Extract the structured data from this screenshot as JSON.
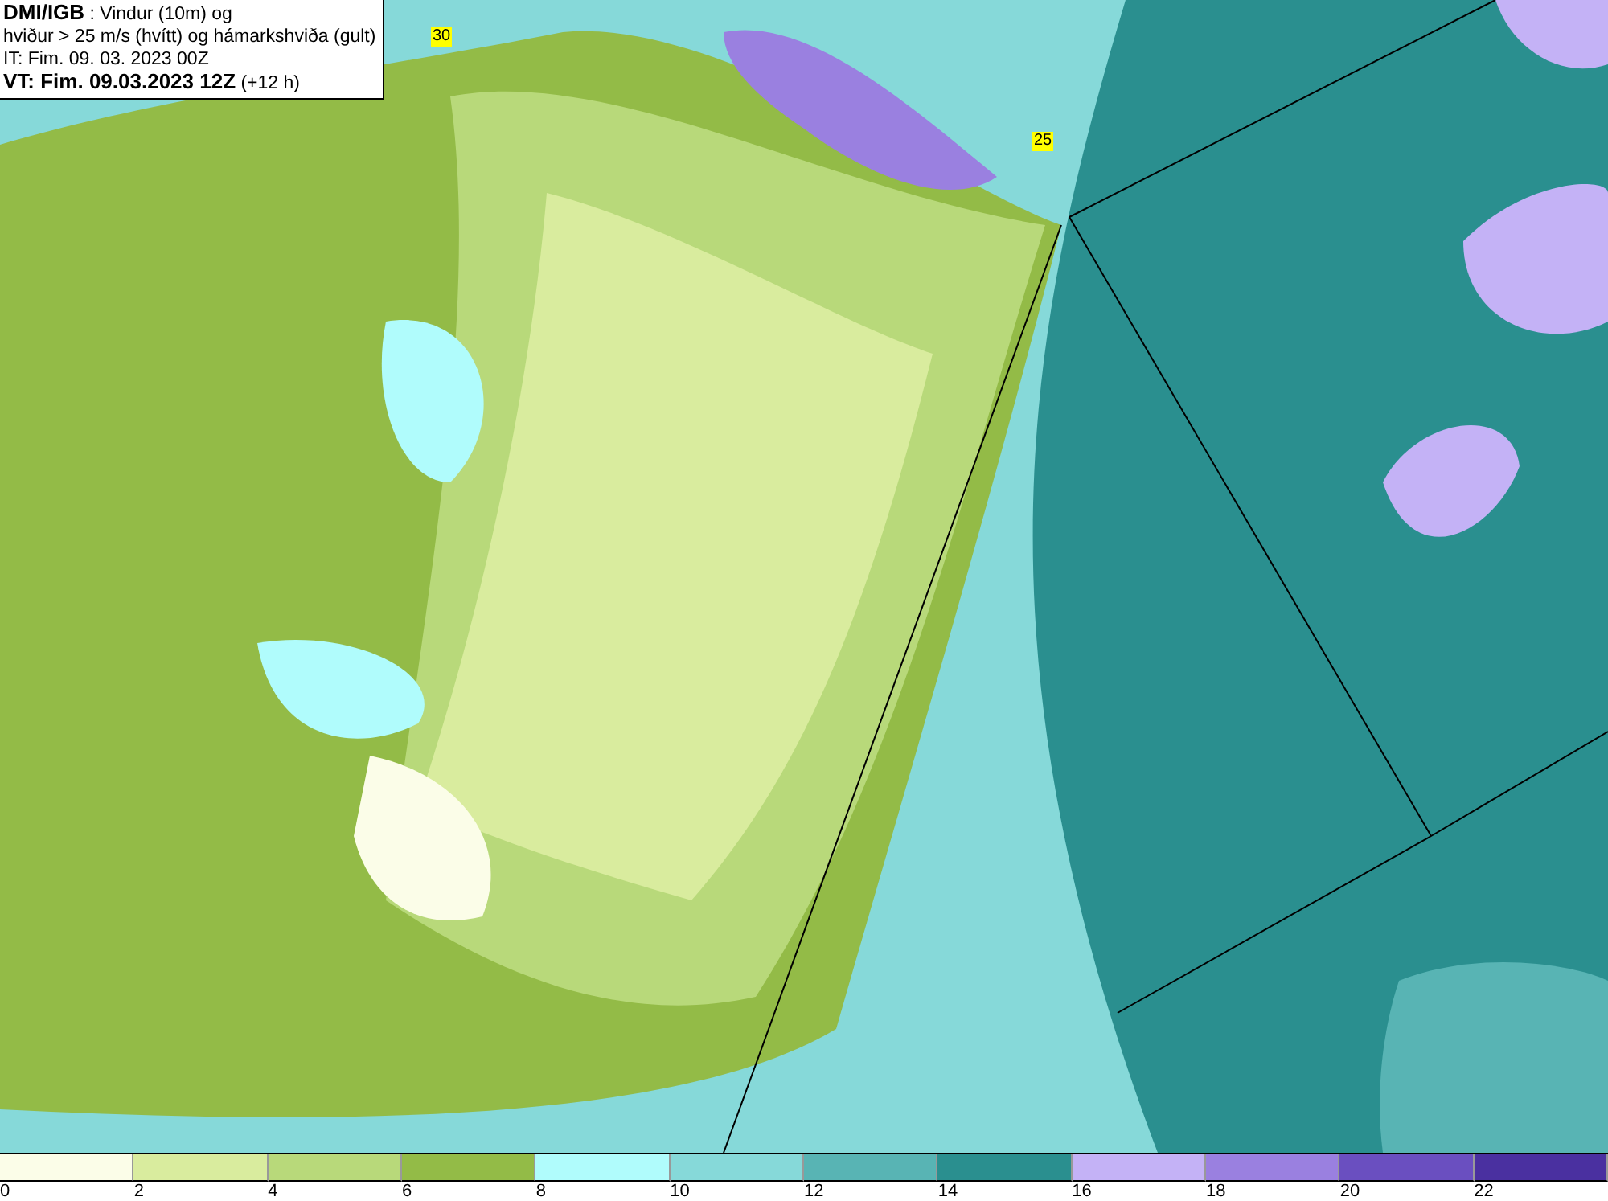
{
  "title_box": {
    "lines": [
      "**DMI/IGB** : Vindur (10m) og",
      "hviður > 25 m/s (hvítt) og hámarkshviða (gult)",
      "IT: Fim. 09. 03. 2023 00Z",
      "**VT: Fim. 09.03.2023 12Z** (+12 h)"
    ]
  },
  "map": {
    "gust_labels": [
      "30",
      "25"
    ]
  },
  "legend": [
    {
      "label": "0",
      "color": "#fbfde8"
    },
    {
      "label": "2",
      "color": "#d9ec9e"
    },
    {
      "label": "4",
      "color": "#b8d97a"
    },
    {
      "label": "6",
      "color": "#93bb47"
    },
    {
      "label": "8",
      "color": "#b0fcfc"
    },
    {
      "label": "10",
      "color": "#86d9d9"
    },
    {
      "label": "12",
      "color": "#58b4b4"
    },
    {
      "label": "14",
      "color": "#2a8f8f"
    },
    {
      "label": "16",
      "color": "#c4b2f6"
    },
    {
      "label": "18",
      "color": "#9a80e0"
    },
    {
      "label": "20",
      "color": "#6a4fc0"
    },
    {
      "label": "22",
      "color": "#4a30a0"
    }
  ]
}
